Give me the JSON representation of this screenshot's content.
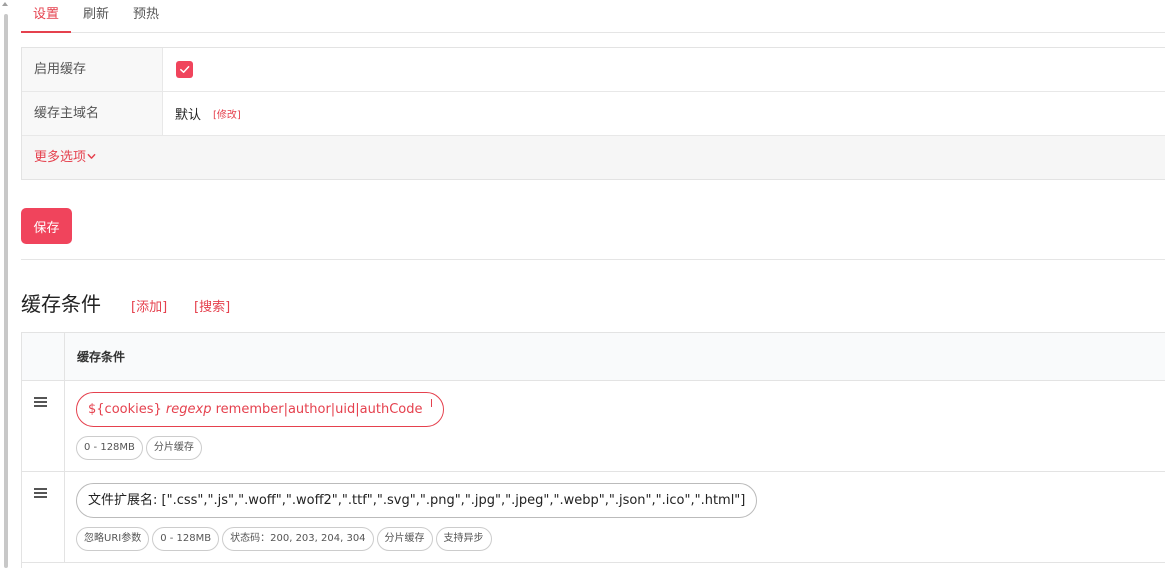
{
  "tabs": [
    {
      "label": "设置",
      "active": true
    },
    {
      "label": "刷新",
      "active": false
    },
    {
      "label": "预热",
      "active": false
    }
  ],
  "settings": {
    "enable_cache_label": "启用缓存",
    "enable_cache_checked": true,
    "domain_label": "缓存主域名",
    "domain_value": "默认",
    "domain_edit_link": "[修改]",
    "more_options": "更多选项"
  },
  "save_label": "保存",
  "conditions": {
    "title": "缓存条件",
    "add_link": "[添加]",
    "search_link": "[搜索]",
    "column_header": "缓存条件",
    "rows": [
      {
        "expr_var": "${cookies}",
        "expr_op": "regexp",
        "expr_value": "remember|author|uid|authCode",
        "tags": [
          "0 - 128MB",
          "分片缓存"
        ]
      },
      {
        "expr_text": "文件扩展名: [\".css\",\".js\",\".woff\",\".woff2\",\".ttf\",\".svg\",\".png\",\".jpg\",\".jpeg\",\".webp\",\".json\",\".ico\",\".html\"]",
        "tags": [
          "忽略URI参数",
          "0 - 128MB",
          "状态码：200, 203, 204, 304",
          "分片缓存",
          "支持异步"
        ]
      }
    ]
  },
  "colors": {
    "accent": "#f0445c",
    "link": "#e5414e"
  }
}
